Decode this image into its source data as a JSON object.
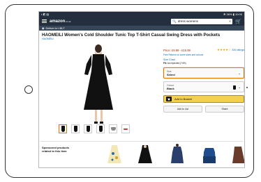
{
  "status": {
    "left": "▪ ◩ ▤",
    "right": "✻ 36% ▮ 10:00"
  },
  "header": {
    "logo": "amazon",
    "logo_suffix": ".co.uk",
    "search_value": "dress womens",
    "search_clear": "✕",
    "cart_icon": "🛒"
  },
  "deliver": {
    "label": "Deliver to LBLT"
  },
  "product": {
    "title": "HAOMEILI Women's Cold Shoulder Tunic Top T-Shirt Casual Swing Dress with Pockets",
    "brand": "HAOMEILI",
    "price": "Price: £9.99 - £15.99",
    "stars": "★★★★☆",
    "ratings": "334 ratings",
    "free_returns": "Free Returns on some sizes and colours",
    "size_chart": "Size Chart",
    "fit_label": "Fit:",
    "fit_value": "As expected (74%)"
  },
  "size_dropdown": {
    "label": "Size",
    "value": "Select"
  },
  "colour_dropdown": {
    "label": "Colour",
    "value": "Black"
  },
  "buttons": {
    "add_to_basket": "Add to Basket",
    "add_to_list": "Add to List",
    "share": "Share"
  },
  "sponsored": {
    "label": "Sponsored products related to this item"
  },
  "colors": {
    "header_bg": "#232f3e",
    "subheader_bg": "#37475a",
    "basket_yellow": "#f3cf52",
    "link_blue": "#0066c0",
    "price_red": "#b12704"
  }
}
